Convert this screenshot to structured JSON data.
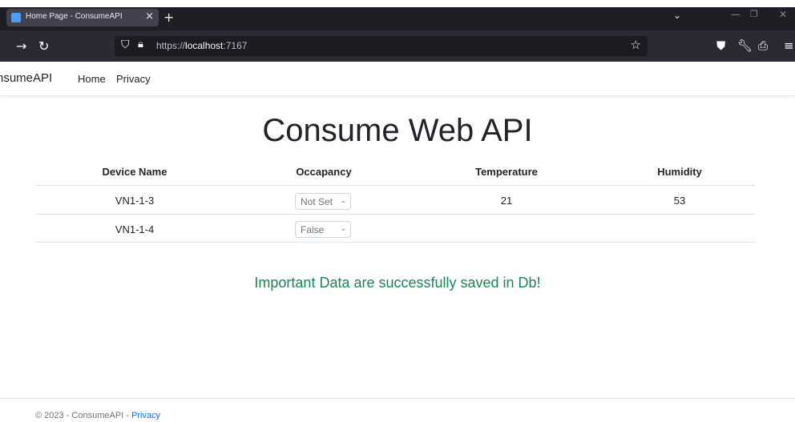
{
  "browser": {
    "tab_title": "Home Page - ConsumeAPI",
    "url_prefix": "https://",
    "url_host": "localhost",
    "url_port": ":7167"
  },
  "site": {
    "brand": "nsumeAPI",
    "nav": [
      "Home",
      "Privacy"
    ]
  },
  "main": {
    "title": "Consume Web API",
    "table": {
      "headers": [
        "Device Name",
        "Occapancy",
        "Temperature",
        "Humidity"
      ],
      "rows": [
        {
          "device": "VN1-1-3",
          "occupancy": "Not Set",
          "temperature": "21",
          "humidity": "53"
        },
        {
          "device": "VN1-1-4",
          "occupancy": "False",
          "temperature": "",
          "humidity": ""
        }
      ]
    },
    "message": "Important Data are successfully saved in Db!"
  },
  "footer": {
    "text": "© 2023 - ConsumeAPI - ",
    "link": "Privacy"
  },
  "colors": {
    "success": "#198754",
    "link": "#0d6efd"
  }
}
